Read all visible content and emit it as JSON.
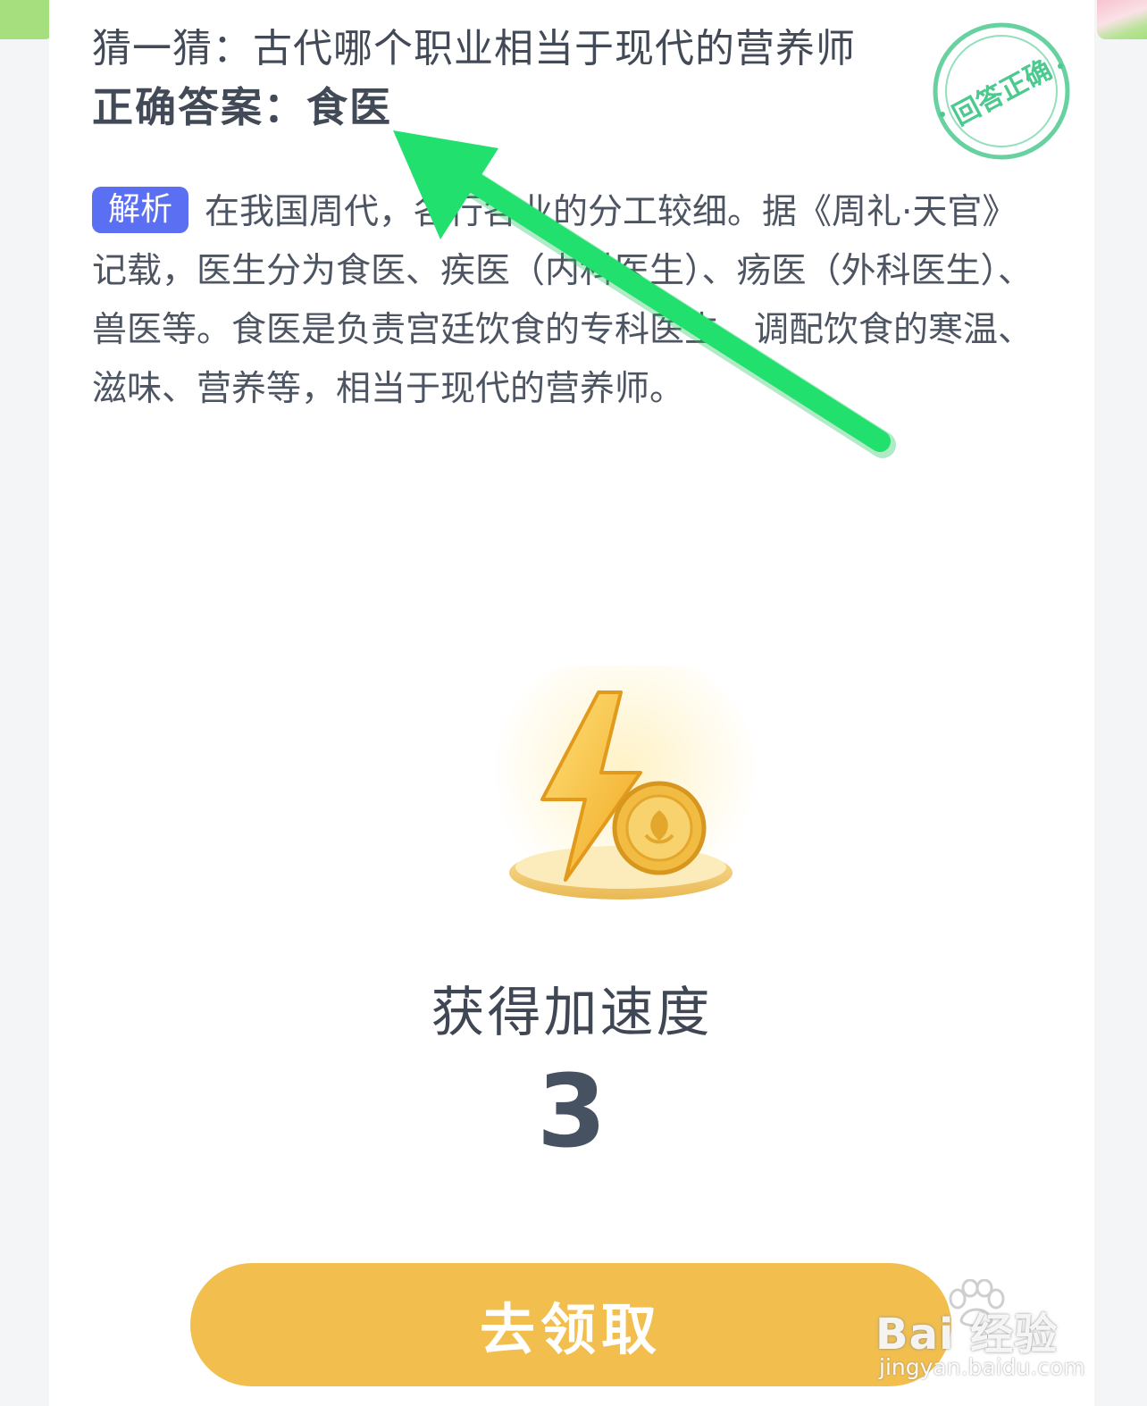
{
  "quiz": {
    "question": "猜一猜：古代哪个职业相当于现代的营养师",
    "answer": "正确答案：食医",
    "stamp_text": "回答正确",
    "analysis_badge": "解析",
    "analysis_text": "在我国周代，各行各业的分工较细。据《周礼·天官》记载，医生分为食医、疾医（内科医生）、疡医（外科医生）、兽医等。食医是负责宫廷饮食的专科医生，调配饮食的寒温、滋味、营养等，相当于现代的营养师。"
  },
  "reward": {
    "label": "获得加速度",
    "value": "3",
    "icon": "lightning-coin-icon"
  },
  "claim_button": {
    "label": "去领取"
  },
  "watermark": {
    "main": "Bai 经验",
    "site": "jingyan.baidu.com"
  },
  "colors": {
    "badge": "#5b6ff2",
    "stamp": "#4cc98f",
    "arrow": "#22e06e",
    "button": "#f2bf4f",
    "text": "#434a57"
  }
}
